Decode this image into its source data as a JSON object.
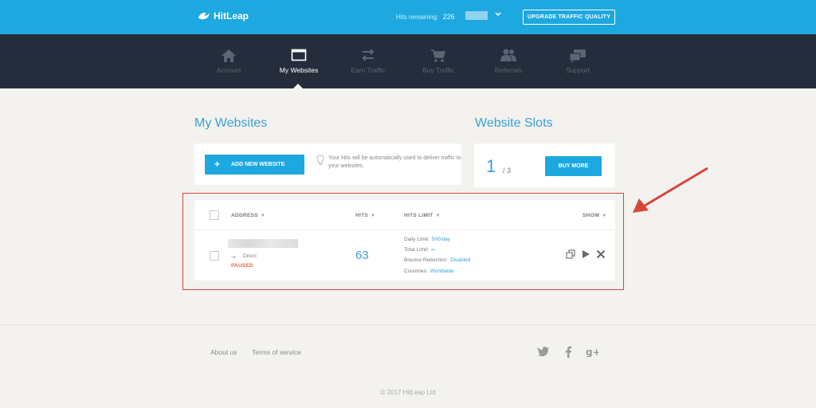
{
  "header": {
    "brand": "HitLeap",
    "hits_remaining_label": "Hits remaining:",
    "hits_remaining_value": "226",
    "upgrade_label": "UPGRADE TRAFFIC QUALITY"
  },
  "nav": {
    "items": [
      {
        "label": "Account",
        "icon": "home-icon"
      },
      {
        "label": "My Websites",
        "icon": "browser-window-icon"
      },
      {
        "label": "Earn Traffic",
        "icon": "swap-arrows-icon"
      },
      {
        "label": "Buy Traffic",
        "icon": "cart-icon"
      },
      {
        "label": "Referrals",
        "icon": "users-icon"
      },
      {
        "label": "Support",
        "icon": "chat-bubbles-icon"
      }
    ],
    "active_index": 1
  },
  "websites": {
    "title": "My Websites",
    "add_button_label": "ADD NEW WEBSITE",
    "info_text": "Your Hits will be automatically used to deliver traffic to your websites."
  },
  "slots": {
    "title": "Website Slots",
    "used": "1",
    "total_label": "/ 3",
    "buy_button_label": "BUY MORE"
  },
  "table": {
    "columns": {
      "address": "ADDRESS",
      "hits": "HITS",
      "hits_limit": "HITS LIMIT",
      "show": "SHOW"
    },
    "rows": [
      {
        "source": "Direct",
        "status": "PAUSED",
        "hits": "63",
        "daily_limit_label": "Daily Limit:",
        "daily_limit_value": "500/day",
        "total_limit_label": "Total Limit:",
        "total_limit_value": "∞",
        "bounce_label": "Bounce Reduction:",
        "bounce_value": "Disabled",
        "countries_label": "Countries:",
        "countries_value": "Worldwide"
      }
    ]
  },
  "footer": {
    "links": [
      "About us",
      "Terms of service"
    ],
    "social": [
      "twitter-icon",
      "facebook-icon",
      "google-plus-icon"
    ],
    "copyright": "© 2017 HitLeap Ltd"
  },
  "colors": {
    "brand_blue": "#1da8e0",
    "nav_bg": "#252d3c",
    "page_bg": "#f3f2ee",
    "accent_text": "#3aa0d6",
    "paused": "#e7643a",
    "highlight_red": "#d9443d"
  }
}
